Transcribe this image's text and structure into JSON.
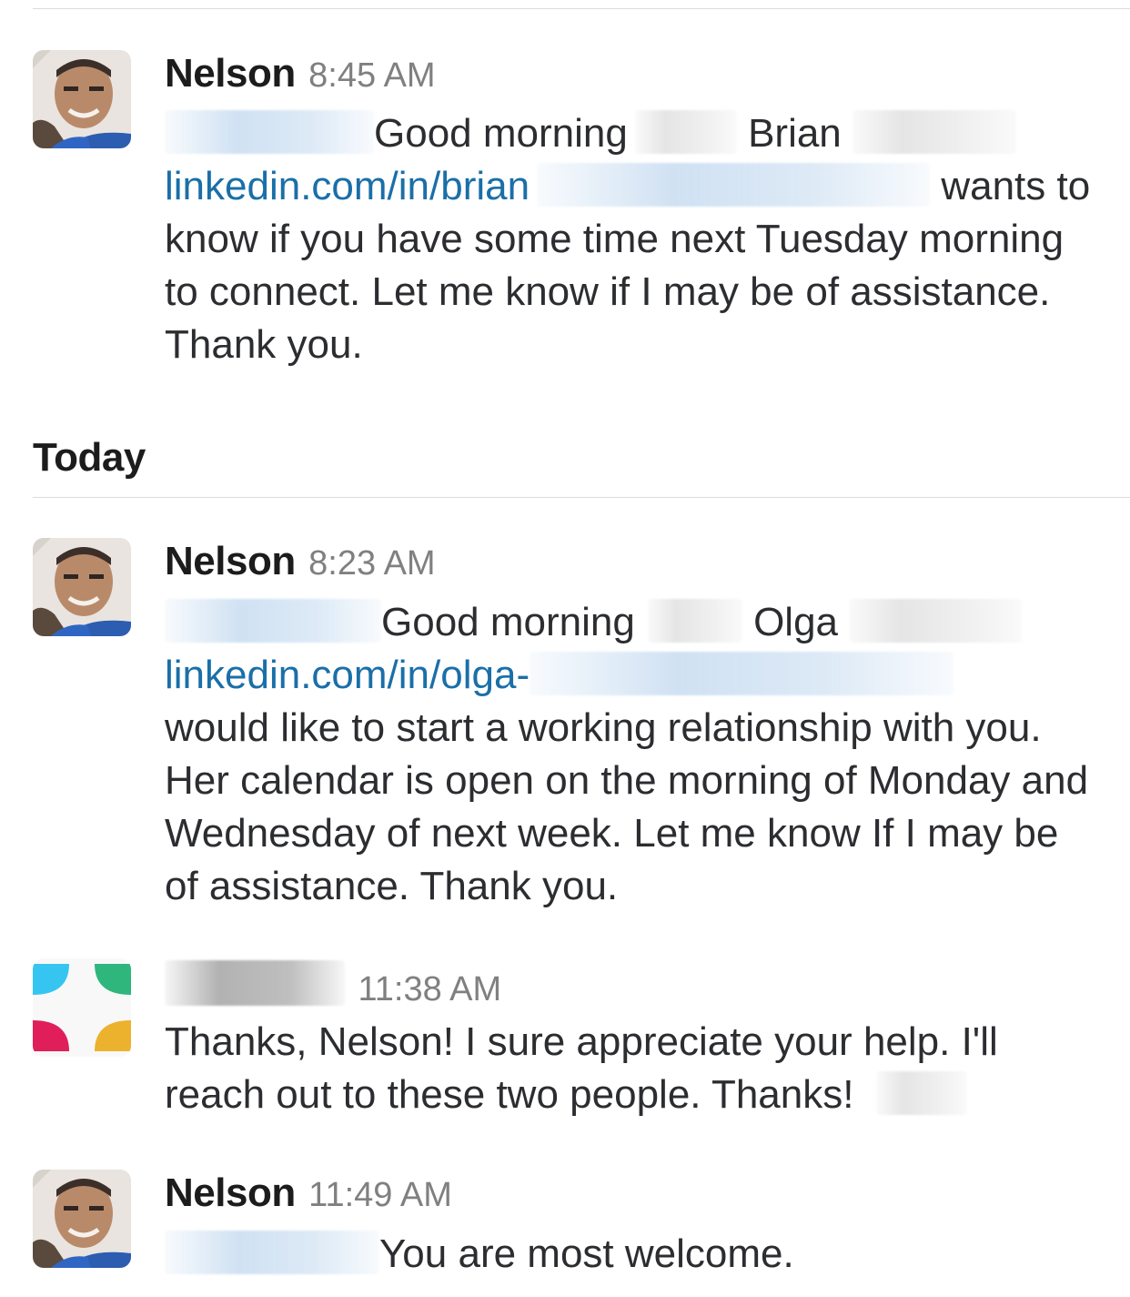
{
  "day_label": "Today",
  "messages": [
    {
      "author": "Nelson",
      "time": "8:45 AM",
      "greeting": "Good morning",
      "contact_first": "Brian",
      "link_text": "linkedin.com/in/brian",
      "after_link": "wants",
      "rest": "to know if you have some time next Tuesday morning to connect. Let me know if I may be of assistance. Thank you."
    },
    {
      "author": "Nelson",
      "time": "8:23 AM",
      "greeting": "Good morning",
      "contact_first": "Olga",
      "link_text": "linkedin.com/in/olga-",
      "rest": " would like to start a working relationship with you. Her calendar is open on the morning of Monday and Wednesday of next week.  Let me know If I may be of assistance. Thank you."
    },
    {
      "time": "11:38 AM",
      "text": "Thanks, Nelson!  I sure appreciate your help.  I'll reach out to these two people.  Thanks!"
    },
    {
      "author": "Nelson",
      "time": "11:49 AM",
      "text": "You are most welcome."
    }
  ],
  "colors": {
    "link": "#1a6fa8",
    "timestamp": "#808080",
    "divider": "#dcdcdc",
    "logo_blue": "#36c5f0",
    "logo_green": "#2eb67d",
    "logo_red": "#e01e5a",
    "logo_yellow": "#ecb22e"
  },
  "icons": {
    "nelson_avatar": "person-avatar-icon",
    "team_avatar": "four-color-logo-icon"
  }
}
